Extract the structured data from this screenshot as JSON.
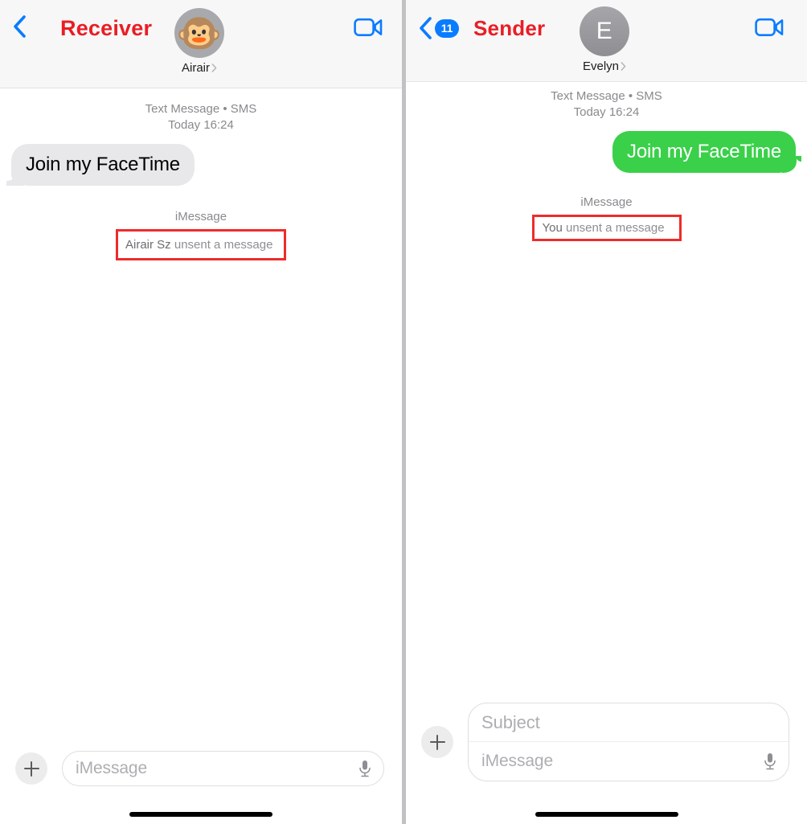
{
  "panels": [
    {
      "role": "receiver",
      "nav": {
        "title": "Receiver",
        "title_color": "#ea1d25",
        "back_icon": "chevron-left-icon",
        "back_badge": null,
        "facetime_icon": "video-camera-icon"
      },
      "contact": {
        "avatar_type": "memoji",
        "avatar_glyph": "🐵",
        "name": "Airair",
        "disclosure_icon": "chevron-right-icon"
      },
      "conversation": {
        "meta_line1": "Text Message • SMS",
        "meta_line2": "Today 16:24",
        "bubble": {
          "text": "Join my FaceTime",
          "direction": "incoming",
          "color": "#e8e8ea",
          "text_color": "#000000"
        },
        "unsent": {
          "service_label": "iMessage",
          "who": "Airair Sz",
          "rest": " unsent a message",
          "highlight_color": "#ef2b2b"
        }
      },
      "composer": {
        "add_icon": "plus-icon",
        "has_subject_field": false,
        "subject_placeholder": null,
        "message_placeholder": "iMessage",
        "mic_icon": "microphone-icon"
      }
    },
    {
      "role": "sender",
      "nav": {
        "title": "Sender",
        "title_color": "#ea1d25",
        "back_icon": "chevron-left-icon",
        "back_badge": "11",
        "badge_color": "#0a7cff",
        "facetime_icon": "video-camera-icon"
      },
      "contact": {
        "avatar_type": "initial",
        "avatar_glyph": "E",
        "name": "Evelyn",
        "disclosure_icon": "chevron-right-icon"
      },
      "conversation": {
        "meta_line1": "Text Message • SMS",
        "meta_line2": "Today 16:24",
        "bubble": {
          "text": "Join my FaceTime",
          "direction": "outgoing",
          "color": "#3ad04a",
          "text_color": "#ffffff"
        },
        "unsent": {
          "service_label": "iMessage",
          "who": "You",
          "rest": " unsent a message",
          "highlight_color": "#ef2b2b"
        }
      },
      "composer": {
        "add_icon": "plus-icon",
        "has_subject_field": true,
        "subject_placeholder": "Subject",
        "message_placeholder": "iMessage",
        "mic_icon": "microphone-icon"
      }
    }
  ]
}
